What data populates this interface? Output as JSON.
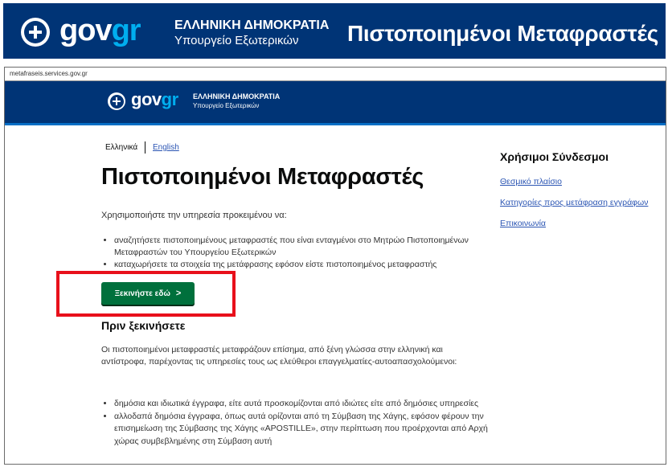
{
  "banner": {
    "logo_gov": "gov",
    "logo_gr": "gr",
    "republic": "ΕΛΛΗΝΙΚΗ ΔΗΜΟΚΡΑΤΙΑ",
    "ministry": "Υπουργείο Εξωτερικών",
    "title": "Πιστοποιημένοι Μεταφραστές"
  },
  "browser": {
    "url": "metafraseis.services.gov.gr"
  },
  "site_header": {
    "logo_gov": "gov",
    "logo_gr": "gr",
    "republic": "ΕΛΛΗΝΙΚΗ ΔΗΜΟΚΡΑΤΙΑ",
    "ministry": "Υπουργείο Εξωτερικών"
  },
  "language": {
    "current": "Ελληνικά",
    "alternate": "English"
  },
  "main": {
    "title": "Πιστοποιημένοι Μεταφραστές",
    "intro": "Χρησιμοποιήστε την υπηρεσία προκειμένου να:",
    "bullets": [
      "αναζητήσετε πιστοποιημένους μεταφραστές που είναι ενταγμένοι στο Μητρώο Πιστοποιημένων Μεταφραστών του Υπουργείου Εξωτερικών",
      "καταχωρήσετε τα στοιχεία της μετάφρασης εφόσον είστε πιστοποιημένος μεταφραστής"
    ],
    "start_button": "Ξεκινήστε εδώ",
    "before_heading": "Πριν ξεκινήσετε",
    "before_text": "Οι πιστοποιημένοι μεταφραστές μεταφράζουν επίσημα, από ξένη γλώσσα στην ελληνική και αντίστροφα, παρέχοντας τις υπηρεσίες τους ως ελεύθεροι επαγγελματίες-αυτοαπασχολούμενοι:",
    "before_bullets": [
      "δημόσια και ιδιωτικά έγγραφα, είτε αυτά προσκομίζονται από ιδιώτες είτε από δημόσιες υπηρεσίες",
      "αλλοδαπά δημόσια έγγραφα, όπως αυτά ορίζονται από τη Σύμβαση της Χάγης, εφόσον φέρουν την επισημείωση της Σύμβασης της Χάγης «APOSTILLE», στην περίπτωση που προέρχονται από Αρχή χώρας συμβεβλημένης στη Σύμβαση αυτή"
    ]
  },
  "sidebar": {
    "heading": "Χρήσιμοι Σύνδεσμοι",
    "links": [
      "Θεσμικό πλαίσιο",
      "Κατηγορίες προς μετάφραση εγγράφων",
      "Επικοινωνία"
    ]
  },
  "colors": {
    "brand_blue": "#003476",
    "accent_blue": "#00aeef",
    "start_green": "#00703c",
    "highlight_red": "#e8101b",
    "link_blue": "#2b55b3"
  },
  "icons": {
    "emblem": "greek-emblem-icon",
    "button_chevron": "chevron-right-icon"
  }
}
